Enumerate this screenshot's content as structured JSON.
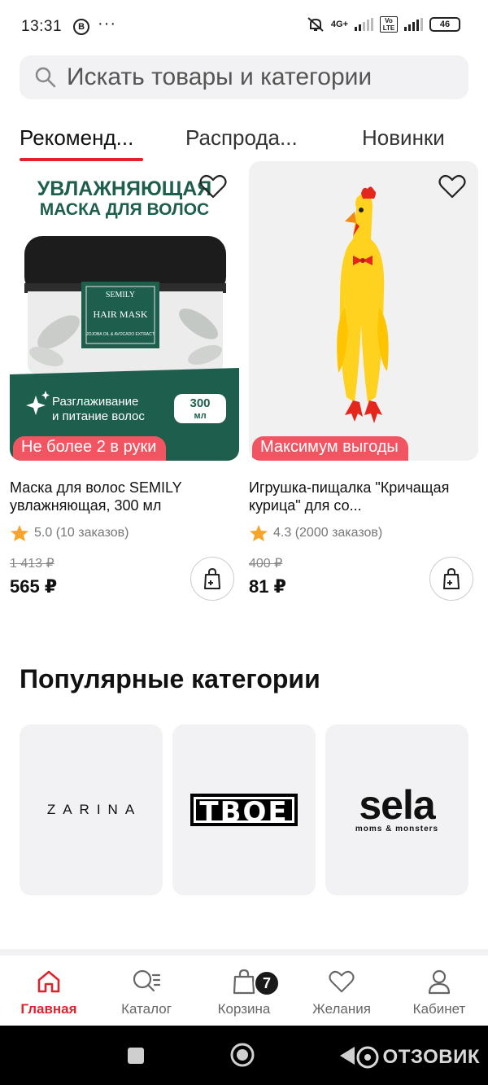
{
  "status_bar": {
    "time": "13:31",
    "app_badge": "В",
    "more": "···",
    "network": "4G+",
    "volte": "Vo LTE",
    "battery": "46"
  },
  "search": {
    "placeholder": "Искать товары и категории"
  },
  "tabs": [
    {
      "label": "Рекоменд...",
      "active": true
    },
    {
      "label": "Распрода...",
      "active": false
    },
    {
      "label": "Новинки",
      "active": false
    }
  ],
  "products": [
    {
      "title": "Маска для волос SEMILY увлажняющая, 300 мл",
      "rating": "5.0",
      "orders": "(10 заказов)",
      "old_price": "1 413 ₽",
      "price": "565 ₽",
      "badge": "Не более 2 в руки",
      "image_text": {
        "headline_1": "УВЛАЖНЯЮЩАЯ",
        "headline_2": "МАСКА ДЛЯ ВОЛОС",
        "brand": "SEMILY",
        "product": "HAIR MASK",
        "ingredients": "JOJOBA OIL & AVOCADO EXTRACT",
        "benefit_1": "Разглаживание",
        "benefit_2": "и питание волос",
        "volume_1": "300",
        "volume_2": "мл"
      }
    },
    {
      "title": "Игрушка-пищалка \"Кричащая курица\" для со...",
      "rating": "4.3",
      "orders": "(2000 заказов)",
      "old_price": "400 ₽",
      "price": "81 ₽",
      "badge": "Максимум выгоды"
    }
  ],
  "popular": {
    "title": "Популярные категории",
    "brands": [
      {
        "name": "ZARINA"
      },
      {
        "name": "TBOE"
      },
      {
        "name": "sela",
        "tagline": "moms & monsters"
      }
    ]
  },
  "bottom_nav": [
    {
      "label": "Главная",
      "icon": "home-icon",
      "active": true
    },
    {
      "label": "Каталог",
      "icon": "catalog-search-icon",
      "active": false
    },
    {
      "label": "Корзина",
      "icon": "cart-bag-icon",
      "active": false,
      "badge": "7"
    },
    {
      "label": "Желания",
      "icon": "heart-icon",
      "active": false
    },
    {
      "label": "Кабинет",
      "icon": "profile-icon",
      "active": false
    }
  ],
  "watermark": "ОТЗОВИК",
  "colors": {
    "accent": "#e3212d",
    "badge": "#f25562",
    "star": "#f4a52a",
    "tile_bg": "#f2f2f4"
  }
}
